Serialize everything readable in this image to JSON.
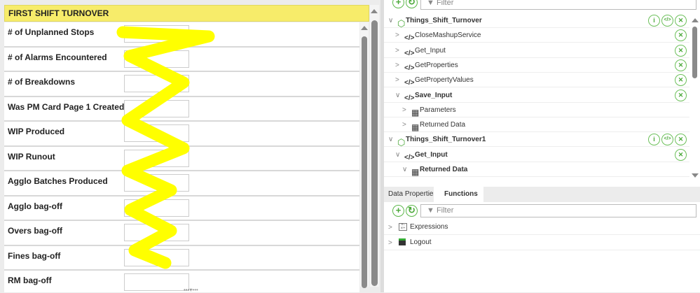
{
  "form": {
    "title": "FIRST SHIFT TURNOVER",
    "fields": [
      {
        "label": "# of Unplanned Stops",
        "value": ""
      },
      {
        "label": "# of Alarms Encountered",
        "value": ""
      },
      {
        "label": "# of Breakdowns",
        "value": ""
      },
      {
        "label": "Was PM Card Page 1 Created?",
        "value": ""
      },
      {
        "label": "WIP Produced",
        "value": ""
      },
      {
        "label": "WIP Runout",
        "value": ""
      },
      {
        "label": "Agglo Batches Produced",
        "value": ""
      },
      {
        "label": "Agglo bag-off",
        "value": ""
      },
      {
        "label": "Overs bag-off",
        "value": ""
      },
      {
        "label": "Fines bag-off",
        "value": ""
      },
      {
        "label": "RM bag-off",
        "value": ""
      }
    ]
  },
  "annotation_color": "#ffff00",
  "data_panel": {
    "filter_placeholder": "Filter",
    "tree": [
      {
        "label": "Things_Shift_Turnover",
        "level": 0,
        "icon": "thing-icon",
        "expanded": true,
        "actions": [
          "info",
          "code",
          "remove"
        ],
        "bold": true
      },
      {
        "label": "CloseMashupService",
        "level": 1,
        "icon": "code-icon",
        "expanded": false,
        "actions": [
          "remove"
        ]
      },
      {
        "label": "Get_Input",
        "level": 1,
        "icon": "code-icon",
        "expanded": false,
        "actions": [
          "remove"
        ]
      },
      {
        "label": "GetProperties",
        "level": 1,
        "icon": "code-icon",
        "expanded": false,
        "actions": [
          "remove"
        ]
      },
      {
        "label": "GetPropertyValues",
        "level": 1,
        "icon": "code-icon",
        "expanded": false,
        "actions": [
          "remove"
        ]
      },
      {
        "label": "Save_Input",
        "level": 1,
        "icon": "code-icon",
        "expanded": true,
        "actions": [
          "remove"
        ],
        "bold": true
      },
      {
        "label": "Parameters",
        "level": 2,
        "icon": "table-icon",
        "expanded": false,
        "actions": []
      },
      {
        "label": "Returned Data",
        "level": 2,
        "icon": "table-icon",
        "expanded": false,
        "actions": []
      },
      {
        "label": "Things_Shift_Turnover1",
        "level": 0,
        "icon": "thing-icon",
        "expanded": true,
        "actions": [
          "info",
          "code",
          "remove"
        ],
        "bold": true
      },
      {
        "label": "Get_Input",
        "level": 1,
        "icon": "code-icon",
        "expanded": true,
        "actions": [
          "remove"
        ],
        "bold": true
      },
      {
        "label": "Returned Data",
        "level": 2,
        "icon": "table-icon",
        "expanded": true,
        "actions": [],
        "bold": true
      }
    ]
  },
  "bottom_panel": {
    "tabs": [
      {
        "label": "Data Properties",
        "active": false
      },
      {
        "label": "Functions",
        "active": true
      }
    ],
    "filter_placeholder": "Filter",
    "items": [
      {
        "label": "Expressions",
        "icon": "expressions-icon"
      },
      {
        "label": "Logout",
        "icon": "logout-icon"
      }
    ]
  }
}
